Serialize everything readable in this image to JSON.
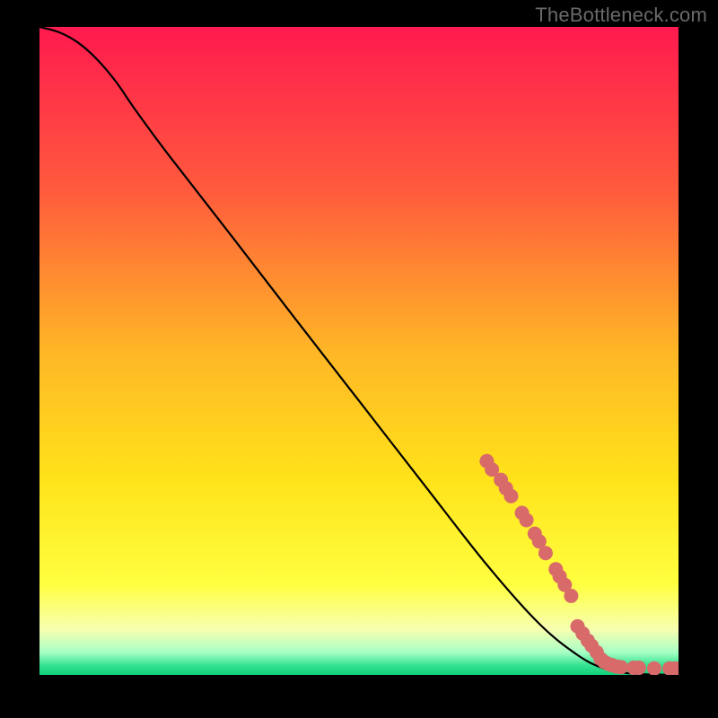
{
  "watermark_text": "TheBottleneck.com",
  "chart_data": {
    "type": "line",
    "title": "",
    "xlabel": "",
    "ylabel": "",
    "xlim": [
      0,
      100
    ],
    "ylim": [
      0,
      100
    ],
    "grid": false,
    "legend": false,
    "background_gradient": {
      "orientation": "vertical",
      "stops": [
        {
          "offset": 0.0,
          "color": "#ff1a4f"
        },
        {
          "offset": 0.25,
          "color": "#ff5a3d"
        },
        {
          "offset": 0.5,
          "color": "#ffb626"
        },
        {
          "offset": 0.7,
          "color": "#ffe31a"
        },
        {
          "offset": 0.86,
          "color": "#ffff40"
        },
        {
          "offset": 0.93,
          "color": "#f7ffb0"
        },
        {
          "offset": 0.965,
          "color": "#a8ffc6"
        },
        {
          "offset": 0.985,
          "color": "#36e390"
        },
        {
          "offset": 1.0,
          "color": "#0fd17a"
        }
      ]
    },
    "series": [
      {
        "name": "bottleneck-curve",
        "color": "#000000",
        "x": [
          0,
          3,
          6,
          9,
          12,
          15,
          20,
          30,
          40,
          50,
          60,
          70,
          78,
          84,
          88,
          91,
          94,
          97,
          100
        ],
        "y": [
          100,
          99.2,
          97.6,
          95.0,
          91.5,
          87.2,
          80.5,
          67.8,
          55.0,
          42.3,
          29.6,
          17.0,
          8.1,
          3.2,
          1.1,
          0.4,
          0.15,
          0.05,
          0.02
        ]
      }
    ],
    "points": {
      "name": "highlighted-range",
      "color": "#d86a6a",
      "radius_px": 8,
      "coords": [
        {
          "x": 70.0,
          "y": 33.0
        },
        {
          "x": 70.8,
          "y": 31.7
        },
        {
          "x": 72.2,
          "y": 30.1
        },
        {
          "x": 73.0,
          "y": 28.8
        },
        {
          "x": 73.8,
          "y": 27.6
        },
        {
          "x": 75.5,
          "y": 25.0
        },
        {
          "x": 76.2,
          "y": 23.9
        },
        {
          "x": 77.5,
          "y": 21.8
        },
        {
          "x": 78.2,
          "y": 20.6
        },
        {
          "x": 79.2,
          "y": 18.8
        },
        {
          "x": 80.8,
          "y": 16.3
        },
        {
          "x": 81.4,
          "y": 15.2
        },
        {
          "x": 82.2,
          "y": 13.9
        },
        {
          "x": 83.2,
          "y": 12.2
        },
        {
          "x": 84.2,
          "y": 7.5
        },
        {
          "x": 85.0,
          "y": 6.4
        },
        {
          "x": 85.8,
          "y": 5.3
        },
        {
          "x": 86.4,
          "y": 4.5
        },
        {
          "x": 87.2,
          "y": 3.5
        },
        {
          "x": 87.8,
          "y": 2.5
        },
        {
          "x": 88.4,
          "y": 2.0
        },
        {
          "x": 89.0,
          "y": 1.7
        },
        {
          "x": 89.6,
          "y": 1.5
        },
        {
          "x": 90.3,
          "y": 1.3
        },
        {
          "x": 91.0,
          "y": 1.2
        },
        {
          "x": 93.0,
          "y": 1.1
        },
        {
          "x": 93.8,
          "y": 1.1
        },
        {
          "x": 96.2,
          "y": 1.0
        },
        {
          "x": 98.6,
          "y": 1.0
        },
        {
          "x": 99.5,
          "y": 1.0
        }
      ]
    }
  }
}
